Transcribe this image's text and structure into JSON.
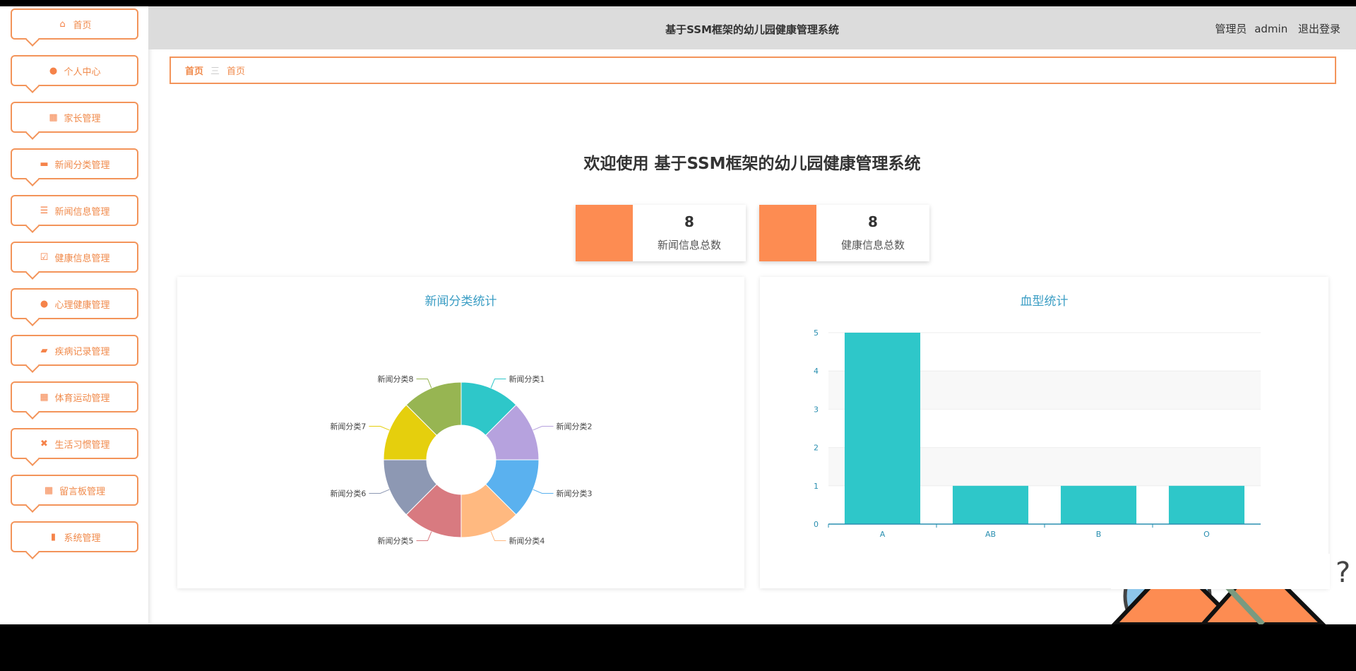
{
  "sidebar": {
    "items": [
      {
        "label": "首页",
        "icon": "home-icon"
      },
      {
        "label": "个人中心",
        "icon": "user-icon"
      },
      {
        "label": "家长管理",
        "icon": "grid-icon"
      },
      {
        "label": "新闻分类管理",
        "icon": "tag-icon"
      },
      {
        "label": "新闻信息管理",
        "icon": "list-icon"
      },
      {
        "label": "健康信息管理",
        "icon": "clipboard-check-icon"
      },
      {
        "label": "心理健康管理",
        "icon": "heart-icon"
      },
      {
        "label": "疾病记录管理",
        "icon": "wallet-icon"
      },
      {
        "label": "体育运动管理",
        "icon": "apps-icon"
      },
      {
        "label": "生活习惯管理",
        "icon": "ticket-icon"
      },
      {
        "label": "留言板管理",
        "icon": "grid-icon"
      },
      {
        "label": "系统管理",
        "icon": "book-icon"
      }
    ]
  },
  "header": {
    "title": "基于SSM框架的幼儿园健康管理系统",
    "role": "管理员",
    "user": "admin",
    "logout": "退出登录"
  },
  "breadcrumb": {
    "items": [
      "首页",
      "首页"
    ],
    "separator": "三"
  },
  "welcome": "欢迎使用 基于SSM框架的幼儿园健康管理系统",
  "stats": [
    {
      "value": "8",
      "label": "新闻信息总数"
    },
    {
      "value": "8",
      "label": "健康信息总数"
    }
  ],
  "accent": "#fd8c52",
  "chart_data": [
    {
      "type": "pie",
      "title": "新闻分类统计",
      "donut": true,
      "labels": [
        "新闻分类1",
        "新闻分类2",
        "新闻分类3",
        "新闻分类4",
        "新闻分类5",
        "新闻分类6",
        "新闻分类7",
        "新闻分类8"
      ],
      "values": [
        1,
        1,
        1,
        1,
        1,
        1,
        1,
        1
      ],
      "colors": [
        "#2ec7c9",
        "#b6a2de",
        "#5ab1ef",
        "#ffb980",
        "#d87a80",
        "#8d98b3",
        "#e5cf0d",
        "#97b552"
      ]
    },
    {
      "type": "bar",
      "title": "血型统计",
      "categories": [
        "A",
        "AB",
        "B",
        "O"
      ],
      "values": [
        5,
        1,
        1,
        1
      ],
      "ylim": [
        0,
        5
      ],
      "yticks": [
        "0",
        "1",
        "2",
        "3",
        "4",
        "5"
      ],
      "color": "#2ec7c9"
    }
  ]
}
